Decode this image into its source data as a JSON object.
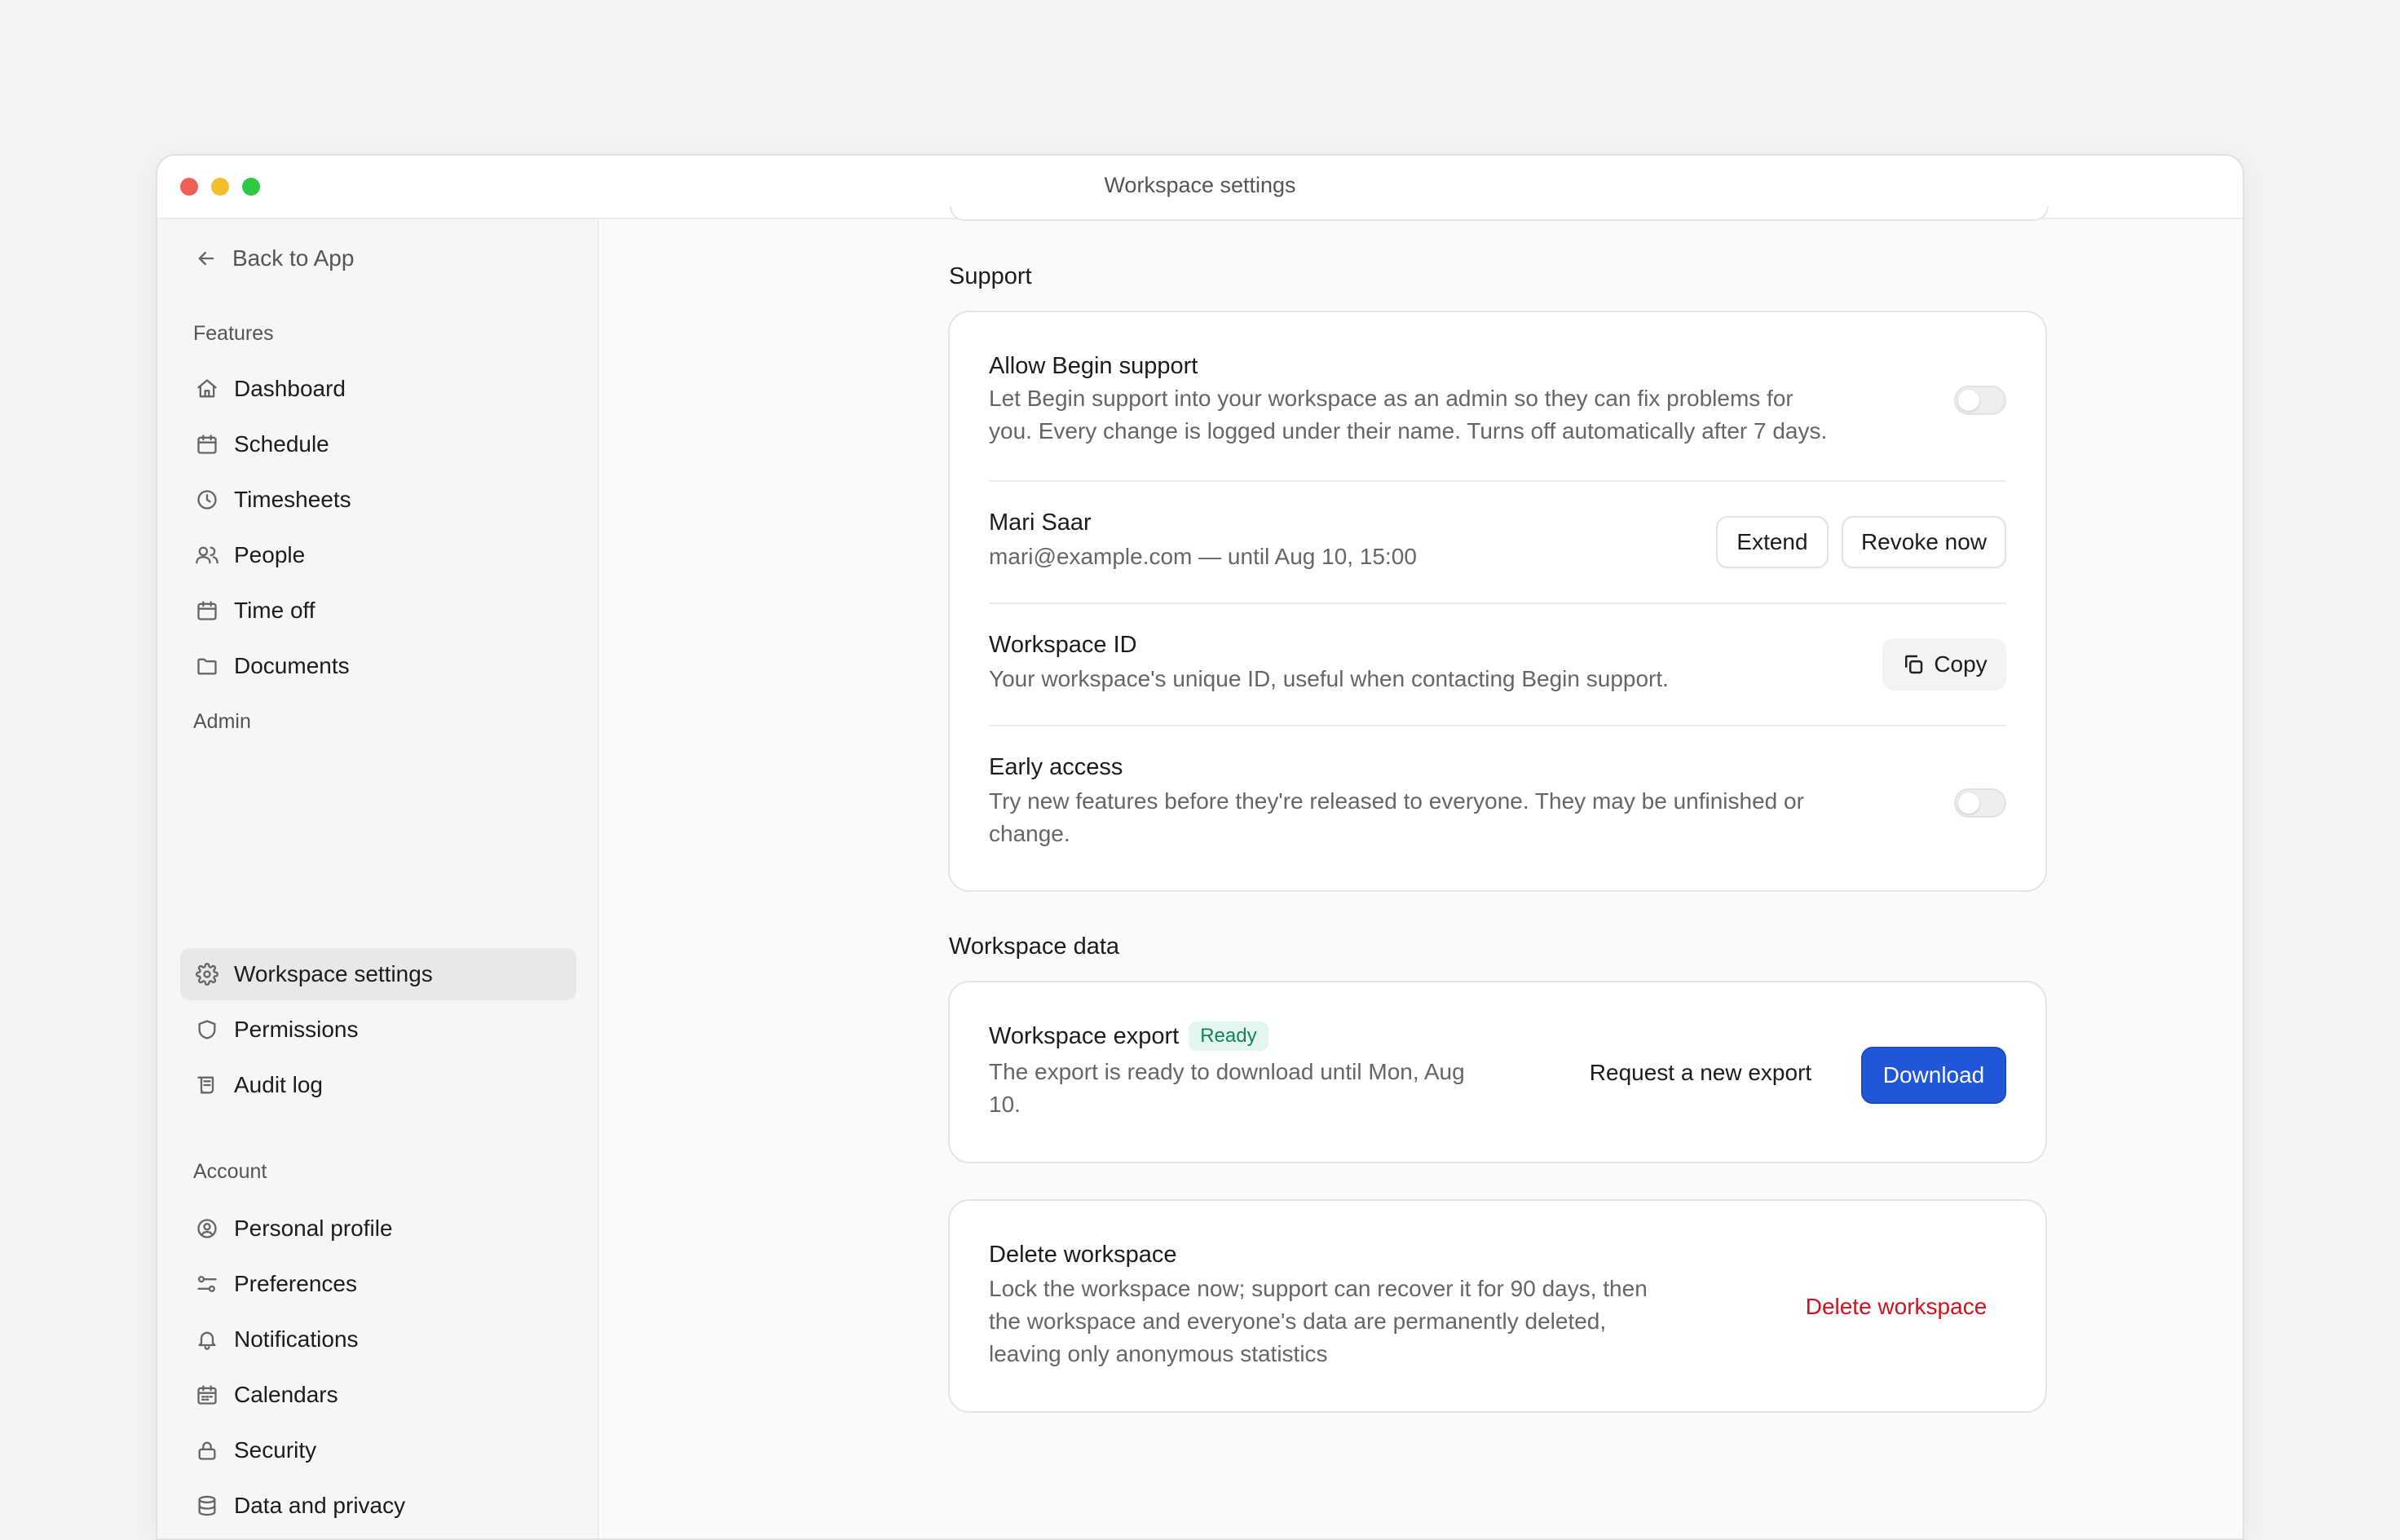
{
  "window": {
    "title": "Workspace settings"
  },
  "sidebar": {
    "back_label": "Back to App",
    "groups": [
      {
        "label": "Features",
        "items": [
          {
            "label": "Dashboard",
            "icon": "home-icon"
          },
          {
            "label": "Schedule",
            "icon": "calendar-icon"
          },
          {
            "label": "Timesheets",
            "icon": "clock-icon"
          },
          {
            "label": "People",
            "icon": "people-icon"
          },
          {
            "label": "Time off",
            "icon": "calendar-icon"
          },
          {
            "label": "Documents",
            "icon": "folder-icon"
          }
        ]
      },
      {
        "label": "Admin",
        "items": [
          {
            "label": "Workspace settings",
            "icon": "gear-icon",
            "active": true
          },
          {
            "label": "Permissions",
            "icon": "shield-icon"
          },
          {
            "label": "Audit log",
            "icon": "scroll-icon"
          }
        ]
      },
      {
        "label": "Account",
        "items": [
          {
            "label": "Personal profile",
            "icon": "user-circle-icon"
          },
          {
            "label": "Preferences",
            "icon": "sliders-icon"
          },
          {
            "label": "Notifications",
            "icon": "bell-icon"
          },
          {
            "label": "Calendars",
            "icon": "calendar-grid-icon"
          },
          {
            "label": "Security",
            "icon": "lock-icon"
          },
          {
            "label": "Data and privacy",
            "icon": "database-icon"
          }
        ]
      }
    ]
  },
  "support": {
    "section_title": "Support",
    "allow": {
      "title": "Allow Begin support",
      "desc_line1": "Let Begin support into your workspace as an admin so they can fix problems for",
      "desc_line2": "you. Every change is logged under their name. Turns off automatically after 7 days.",
      "enabled": false
    },
    "grant": {
      "name": "Mari Saar",
      "detail": "mari@example.com — until Aug 10, 15:00",
      "extend_label": "Extend",
      "revoke_label": "Revoke now"
    },
    "workspace_id": {
      "title": "Workspace ID",
      "desc": "Your workspace's unique ID, useful when contacting Begin support.",
      "copy_label": "Copy"
    },
    "early_access": {
      "title": "Early access",
      "desc_line1": "Try new features before they're released to everyone. They may be unfinished or",
      "desc_line2": "change.",
      "enabled": false
    }
  },
  "workspace_data": {
    "section_title": "Workspace data",
    "export": {
      "title": "Workspace export",
      "badge": "Ready",
      "desc_line1": "The export is ready to download until Mon, Aug",
      "desc_line2": "10.",
      "request_label": "Request a new export",
      "download_label": "Download"
    }
  },
  "delete": {
    "title": "Delete workspace",
    "desc_line1": "Lock the workspace now; support can recover it for 90 days, then",
    "desc_line2": "the workspace and everyone's data are permanently deleted,",
    "desc_line3": "leaving only anonymous statistics",
    "button_label": "Delete workspace"
  },
  "colors": {
    "primary": "#1f57d8",
    "danger": "#d0121b",
    "ready_badge_text": "#12835d",
    "ready_badge_bg": "#e3f6ed"
  }
}
